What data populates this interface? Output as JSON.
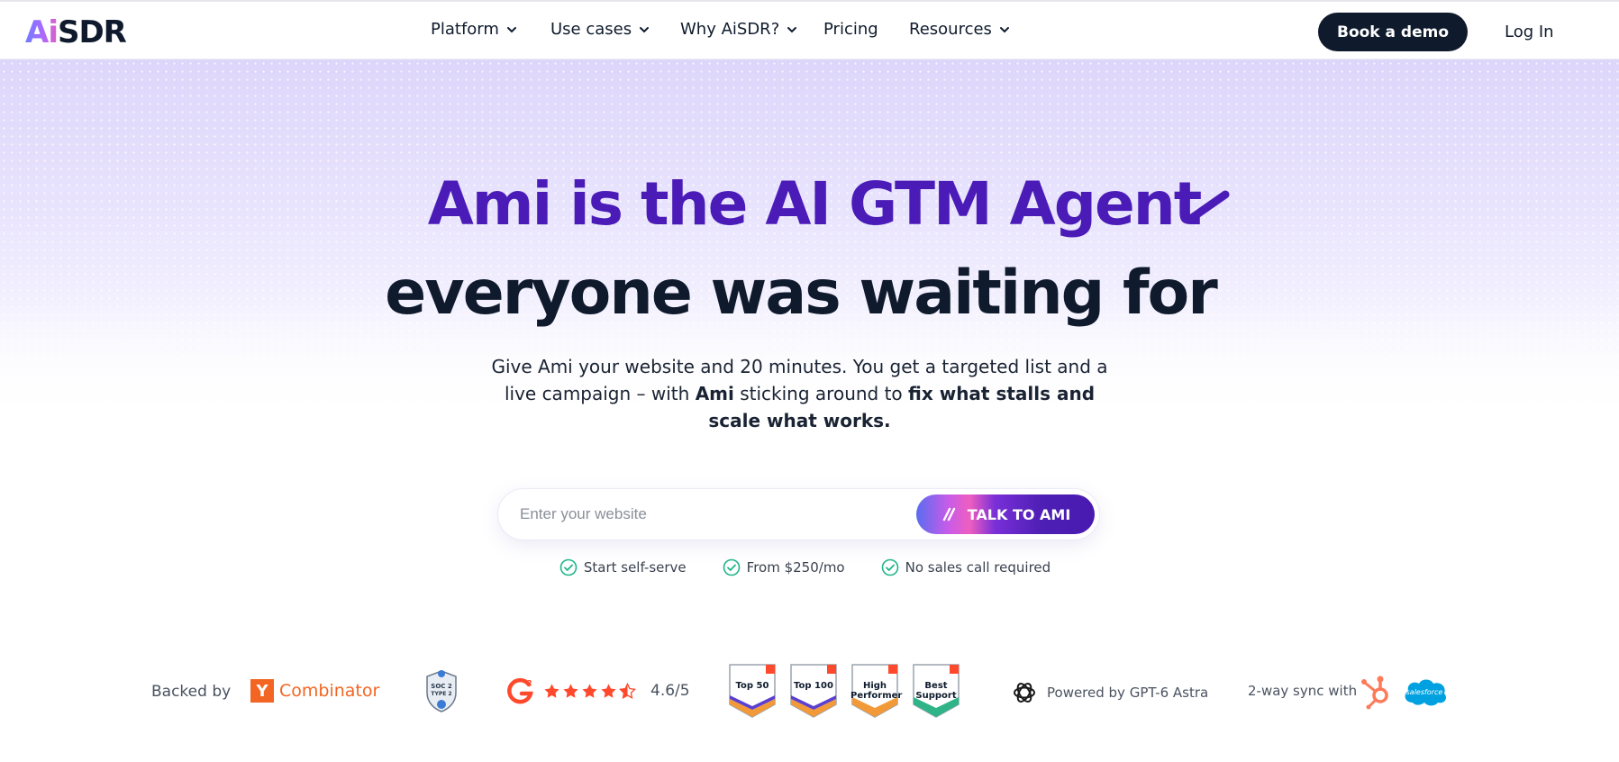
{
  "brand": {
    "logo_ai": "Ai",
    "logo_rest": "SDR"
  },
  "nav": {
    "items": [
      {
        "label": "Platform",
        "has_dropdown": true
      },
      {
        "label": "Use cases",
        "has_dropdown": true
      },
      {
        "label": "Why AiSDR?",
        "has_dropdown": true
      },
      {
        "label": "Pricing",
        "has_dropdown": false
      },
      {
        "label": "Resources",
        "has_dropdown": true
      }
    ],
    "cta_label": "Book a demo",
    "login_label": "Log In"
  },
  "hero": {
    "headline_line1": "Ami is the AI GTM Agent",
    "headline_line2": "everyone was waiting for",
    "sub_part1": "Give Ami your website and 20 minutes. You get a targeted list and a live campaign – with ",
    "sub_bold1": "Ami",
    "sub_part2": " sticking around to ",
    "sub_bold2": "fix what stalls and scale what works."
  },
  "signup": {
    "placeholder": "Enter your website",
    "button_label": "TALK TO AMI"
  },
  "checks": [
    {
      "label": "Start self-serve"
    },
    {
      "label": "From $250/mo"
    },
    {
      "label": "No sales call required"
    }
  ],
  "trust": {
    "backed_by": "Backed by",
    "yc_letter": "Y",
    "yc_name": "Combinator",
    "soc_label_1": "SOC 2",
    "soc_label_2": "TYPE 2",
    "g2_rating": "4.6/5",
    "g2_stars": 4.5,
    "badges": [
      {
        "title": "Top 50"
      },
      {
        "title": "Top 100"
      },
      {
        "title": "High Performer"
      },
      {
        "title": "Best Support"
      }
    ],
    "powered_by": "Powered by GPT-6 Astra",
    "sync_label": "2-way sync with",
    "salesforce_label": "salesforce"
  },
  "colors": {
    "primary_dark": "#0f1b2d",
    "accent_purple": "#4b1bb8",
    "check_green": "#1fb58a",
    "g2_red": "#ff492c",
    "yc_orange": "#f26522",
    "hubspot_orange": "#ff7a59",
    "salesforce_blue": "#00a1e0"
  }
}
